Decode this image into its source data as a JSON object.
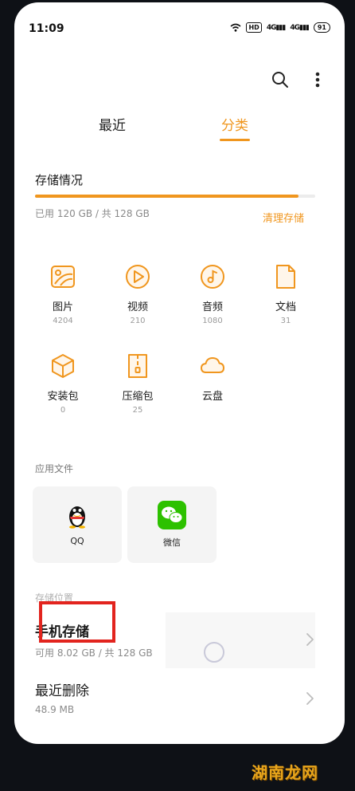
{
  "status_bar": {
    "time": "11:09",
    "hd_label": "HD",
    "signal_1": "4G",
    "signal_2": "4G",
    "battery": "91"
  },
  "tabs": [
    {
      "label": "最近",
      "active": false
    },
    {
      "label": "分类",
      "active": true
    }
  ],
  "storage": {
    "title": "存储情况",
    "used_text": "已用 120 GB / 共 128 GB",
    "used_fraction": 0.94,
    "clean_label": "清理存储"
  },
  "categories": [
    {
      "label": "图片",
      "count": "4204",
      "icon": "image-icon"
    },
    {
      "label": "视频",
      "count": "210",
      "icon": "video-play-icon"
    },
    {
      "label": "音频",
      "count": "1080",
      "icon": "music-note-icon"
    },
    {
      "label": "文档",
      "count": "31",
      "icon": "document-icon"
    },
    {
      "label": "安装包",
      "count": "0",
      "icon": "package-box-icon"
    },
    {
      "label": "压缩包",
      "count": "25",
      "icon": "zip-archive-icon"
    },
    {
      "label": "云盘",
      "count": "",
      "icon": "cloud-icon"
    }
  ],
  "app_files": {
    "title": "应用文件",
    "apps": [
      {
        "label": "QQ",
        "icon": "qq-penguin-icon"
      },
      {
        "label": "微信",
        "icon": "wechat-icon"
      }
    ]
  },
  "storage_location": {
    "title": "存储位置",
    "items": [
      {
        "title": "手机存储",
        "subtitle": "可用 8.02 GB / 共 128 GB"
      },
      {
        "title": "最近删除",
        "subtitle": "48.9 MB"
      }
    ]
  },
  "watermark": "湖南龙网",
  "colors": {
    "accent": "#f0961e",
    "annotation": "#e2241e",
    "wechat_green": "#2dc100"
  }
}
